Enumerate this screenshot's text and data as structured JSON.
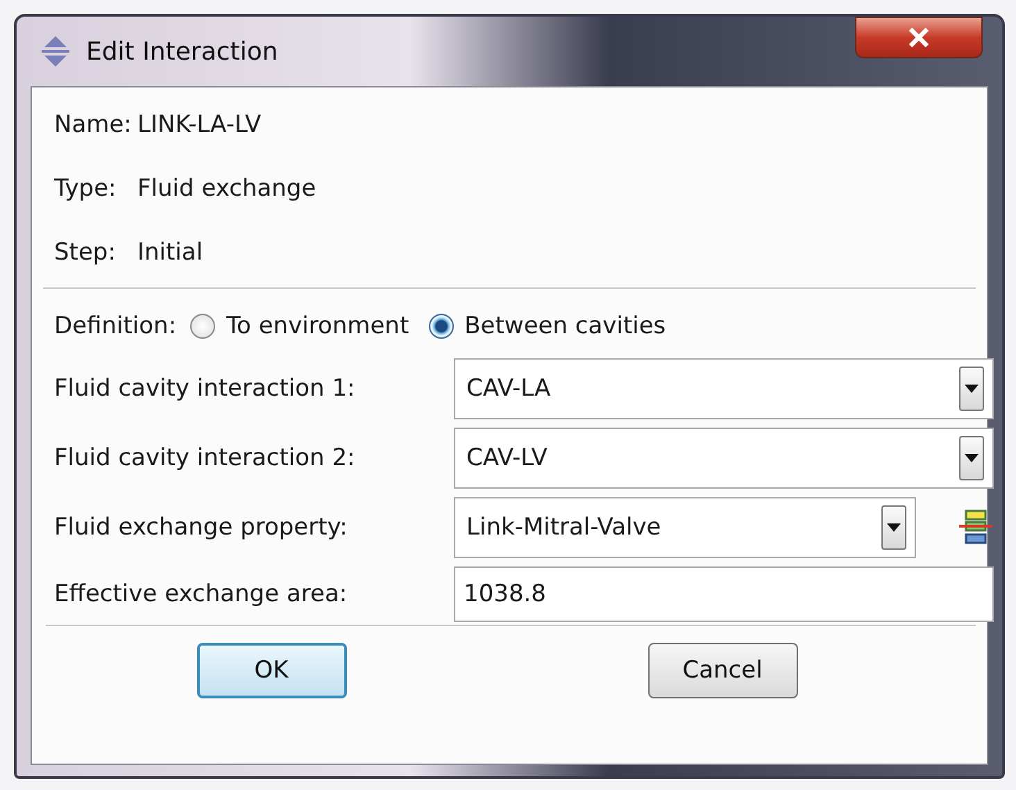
{
  "window": {
    "title": "Edit Interaction"
  },
  "info": [
    {
      "label": "Name:",
      "value": "LINK-LA-LV"
    },
    {
      "label": "Type:",
      "value": "Fluid exchange"
    },
    {
      "label": "Step:",
      "value": "Initial"
    }
  ],
  "definition": {
    "label": "Definition:",
    "options": [
      {
        "label": "To environment",
        "selected": false
      },
      {
        "label": "Between cavities",
        "selected": true
      }
    ]
  },
  "fields": [
    {
      "kind": "dropdown",
      "label": "Fluid cavity interaction 1:",
      "value": "CAV-LA",
      "editor": false
    },
    {
      "kind": "dropdown",
      "label": "Fluid cavity interaction 2:",
      "value": "CAV-LV",
      "editor": false
    },
    {
      "kind": "dropdown",
      "label": "Fluid exchange property:",
      "value": "Link-Mitral-Valve",
      "editor": true
    },
    {
      "kind": "text",
      "label": "Effective exchange area:",
      "value": "1038.8",
      "editor": false
    }
  ],
  "buttons": [
    {
      "label": "OK",
      "focused": true
    },
    {
      "label": "Cancel",
      "focused": false
    }
  ]
}
